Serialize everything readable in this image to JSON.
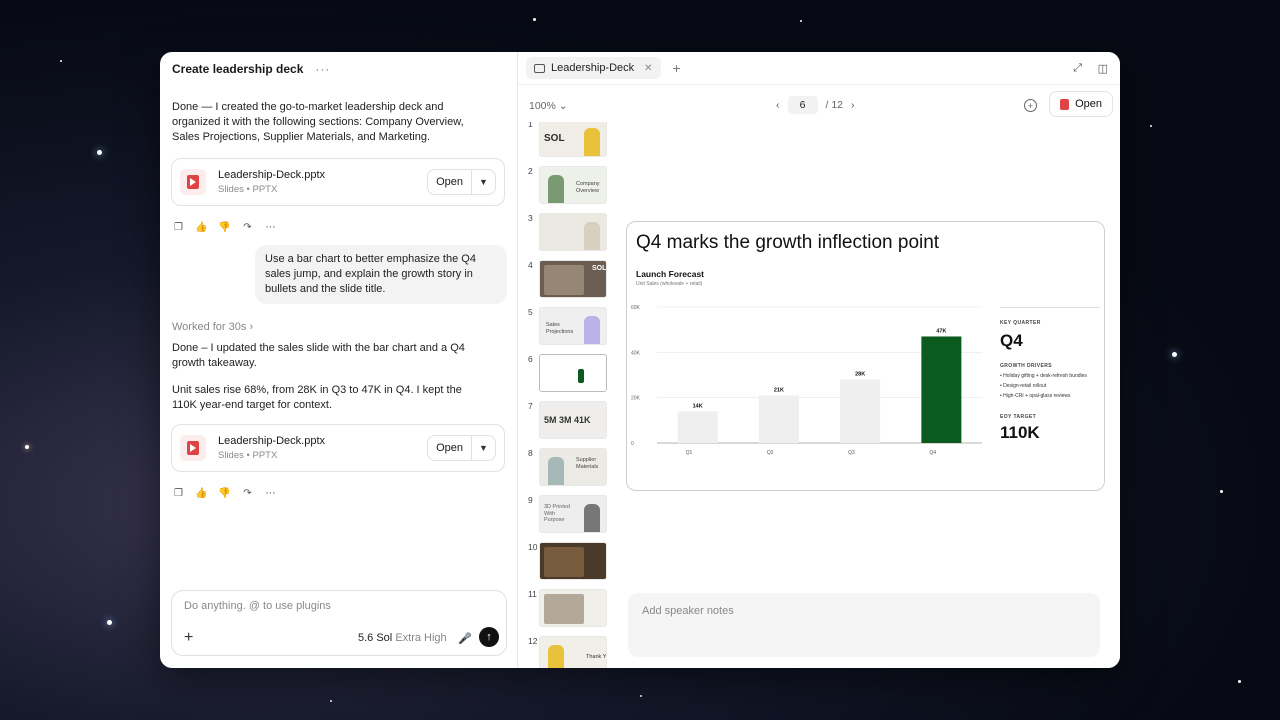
{
  "chat": {
    "title": "Create leadership deck",
    "menu": "···",
    "msg1": "Done — I created the go-to-market leadership deck and organized it with the following sections: Company Overview, Sales Projections, Supplier Materials, and Marketing.",
    "file": {
      "name": "Leadership-Deck.pptx",
      "sub": "Slides • PPTX",
      "open": "Open"
    },
    "user_msg": "Use a bar chart to better emphasize the Q4 sales jump, and explain the growth story in bullets and the slide title.",
    "worked": "Worked for 30s",
    "msg2": "Done – I updated the sales slide with the bar chart and a Q4 growth takeaway.",
    "msg3": "Unit sales rise 68%, from 28K in Q3 to 47K in Q4. I kept the 110K year-end target for context.",
    "composer": {
      "placeholder": "Do anything. @ to use plugins",
      "model": "5.6 Sol",
      "mode": "Extra High"
    }
  },
  "preview": {
    "tab": "Leadership-Deck",
    "zoom": "100%",
    "page": "6",
    "total": "/ 12",
    "open": "Open",
    "notes_placeholder": "Add speaker notes",
    "thumbs": [
      {
        "num": "1",
        "text": "SOL"
      },
      {
        "num": "2",
        "text": "Company Overview"
      },
      {
        "num": "3",
        "text": ""
      },
      {
        "num": "4",
        "text": "SOL"
      },
      {
        "num": "5",
        "text": "Sales Projections"
      },
      {
        "num": "6",
        "text": ""
      },
      {
        "num": "7",
        "text": "5M  3M  41K"
      },
      {
        "num": "8",
        "text": "Supplier Materials"
      },
      {
        "num": "9",
        "text": "3D Printed With Purpose"
      },
      {
        "num": "10",
        "text": ""
      },
      {
        "num": "11",
        "text": ""
      },
      {
        "num": "12",
        "text": "Thank You"
      }
    ],
    "slide": {
      "title": "Q4 marks the growth inflection point",
      "chart_title": "Launch Forecast",
      "chart_sub": "Unit Sales (wholesale + retail)",
      "key_quarter_label": "KEY QUARTER",
      "key_quarter": "Q4",
      "drivers_label": "GROWTH DRIVERS",
      "drivers": [
        "• Holiday gifting + desk-refresh bundles",
        "• Design-retail rollout",
        "• High-CRI + opal-glass reviews"
      ],
      "target_label": "EOY TARGET",
      "target": "110K"
    }
  },
  "chart_data": {
    "type": "bar",
    "categories": [
      "Q1",
      "Q2",
      "Q3",
      "Q4"
    ],
    "values": [
      14,
      21,
      28,
      47
    ],
    "labels": [
      "14K",
      "21K",
      "28K",
      "47K"
    ],
    "title": "Launch Forecast",
    "ylabel": "Unit Sales (wholesale + retail)",
    "yticks": [
      "0",
      "20K",
      "40K",
      "60K"
    ],
    "ylim": [
      0,
      60
    ],
    "colors": {
      "default": "#efefef",
      "highlight": "#0b5a1e"
    },
    "highlight_index": 3
  }
}
